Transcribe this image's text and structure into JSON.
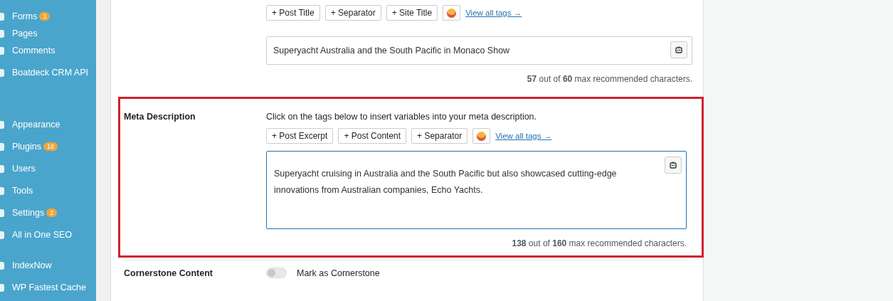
{
  "sidebar": {
    "items": [
      {
        "label": "Forms",
        "badge": "1"
      },
      {
        "label": "Pages"
      },
      {
        "label": "Comments"
      },
      {
        "label": "Boatdeck CRM API"
      },
      {
        "label": "Appearance"
      },
      {
        "label": "Plugins",
        "badge": "18"
      },
      {
        "label": "Users"
      },
      {
        "label": "Tools"
      },
      {
        "label": "Settings",
        "badge": "2"
      },
      {
        "label": "All in One SEO"
      },
      {
        "label": "IndexNow"
      },
      {
        "label": "WP Fastest Cache"
      }
    ]
  },
  "post_title": {
    "tags": [
      "+ Post Title",
      "+ Separator",
      "+ Site Title"
    ],
    "view_all": "View all tags →",
    "value": "Superyacht Australia and the South Pacific in Monaco Show",
    "count": "**57** out of **60** max recommended characters."
  },
  "meta_description": {
    "label": "Meta Description",
    "hint": "Click on the tags below to insert variables into your meta description.",
    "tags": [
      "+ Post Excerpt",
      "+ Post Content",
      "+ Separator"
    ],
    "view_all": "View all tags →",
    "value": "Superyacht cruising in Australia and the South Pacific but also showcased cutting-edge innovations from Australian companies, Echo Yachts.",
    "count": "**138** out of **160** max recommended characters.",
    "highlighted": true
  },
  "cornerstone": {
    "label": "Cornerstone Content",
    "toggle_label": "Mark as Cornerstone",
    "on": false
  }
}
